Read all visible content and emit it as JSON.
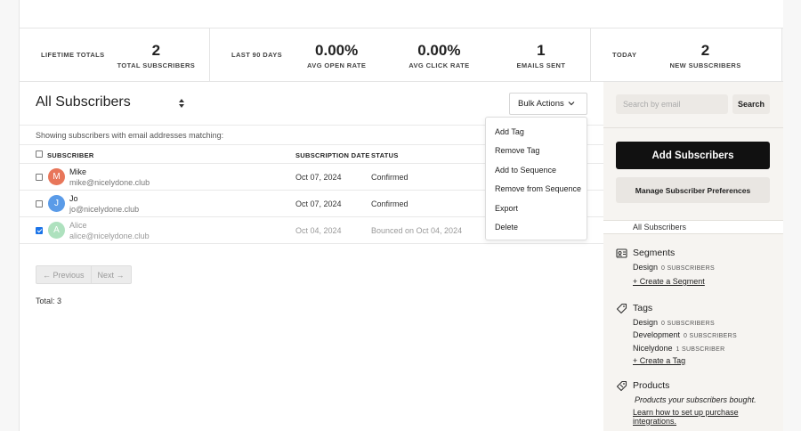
{
  "stats": {
    "lifetime_label": "LIFETIME TOTALS",
    "total_subscribers": {
      "value": "2",
      "caption": "TOTAL SUBSCRIBERS"
    },
    "last90_label": "LAST 90 DAYS",
    "avg_open_rate": {
      "value": "0.00%",
      "caption": "AVG OPEN RATE"
    },
    "avg_click_rate": {
      "value": "0.00%",
      "caption": "AVG CLICK RATE"
    },
    "emails_sent": {
      "value": "1",
      "caption": "EMAILS SENT"
    },
    "today_label": "TODAY",
    "new_subscribers": {
      "value": "2",
      "caption": "NEW SUBSCRIBERS"
    }
  },
  "list": {
    "title": "All Subscribers",
    "bulk_actions": "Bulk Actions",
    "matching_text": "Showing subscribers with email addresses matching:",
    "columns": {
      "subscriber": "SUBSCRIBER",
      "date": "SUBSCRIPTION DATE",
      "status": "STATUS"
    },
    "rows": [
      {
        "initial": "M",
        "name": "Mike",
        "email": "mike@nicelydone.club",
        "date": "Oct 07, 2024",
        "status": "Confirmed",
        "avatar_color": "#e8765a",
        "checked": false
      },
      {
        "initial": "J",
        "name": "Jo",
        "email": "jo@nicelydone.club",
        "date": "Oct 07, 2024",
        "status": "Confirmed",
        "avatar_color": "#5a9be8",
        "checked": false
      },
      {
        "initial": "A",
        "name": "Alice",
        "email": "alice@nicelydone.club",
        "date": "Oct 04, 2024",
        "status": "Bounced on Oct 04, 2024",
        "avatar_color": "#6cc98a",
        "checked": true
      }
    ],
    "previous": "← Previous",
    "next": "Next →",
    "total": "Total: 3"
  },
  "bulk_menu": [
    "Add Tag",
    "Remove Tag",
    "Add to Sequence",
    "Remove from Sequence",
    "Export",
    "Delete"
  ],
  "sidebar": {
    "search_placeholder": "Search by email",
    "search_button": "Search",
    "add_subscribers": "Add Subscribers",
    "manage_preferences": "Manage Subscriber Preferences",
    "all_subscribers": "All Subscribers",
    "segments": {
      "title": "Segments",
      "items": [
        {
          "name": "Design",
          "count": "0 SUBSCRIBERS"
        }
      ],
      "create": "+ Create a Segment"
    },
    "tags": {
      "title": "Tags",
      "items": [
        {
          "name": "Design",
          "count": "0 SUBSCRIBERS"
        },
        {
          "name": "Development",
          "count": "0 SUBSCRIBERS"
        },
        {
          "name": "Nicelydone",
          "count": "1 SUBSCRIBER"
        }
      ],
      "create": "+ Create a Tag"
    },
    "products": {
      "title": "Products",
      "description": "Products your subscribers bought.",
      "link": "Learn how to set up purchase integrations."
    }
  }
}
